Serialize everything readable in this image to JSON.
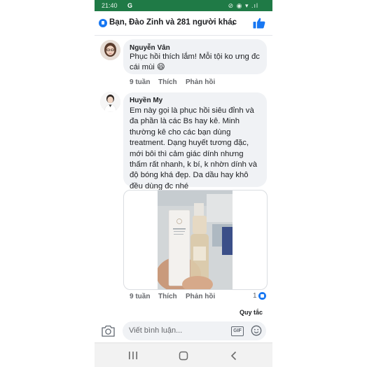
{
  "status_bar": {
    "time": "21:40",
    "google": "G",
    "signals": "⊘ ◉ ▾ .ıl"
  },
  "reactions": {
    "text": "Bạn, Đào Zinh và 281 người khác",
    "chevron": "›"
  },
  "comments": [
    {
      "author": "Nguyễn Vân",
      "text": "Phục hồi thích lắm! Mỗi tội ko ưng đc cái mùi 😄",
      "time": "9 tuần",
      "like": "Thích",
      "reply": "Phản hồi"
    },
    {
      "author": "Huyền My",
      "text": "Em này gọi là phục hồi siêu đỉnh và đa phần là các Bs hay kê. Minh thường kê cho các bạn dùng treatment. Dạng huyết tương đặc, mới bôi thì cảm giác dính nhưng thấm rất nhanh, k bí, k nhờn dính và độ bóng khá đẹp. Da dầu hay khô đều dùng đc nhé",
      "time": "9 tuần",
      "like": "Thích",
      "reply": "Phản hồi",
      "reaction_count": "1"
    }
  ],
  "rules_label": "Quy tắc",
  "composer": {
    "placeholder": "Viết bình luận...",
    "gif": "GIF"
  },
  "icons": {
    "reaction": "like-reaction-icon",
    "thumb": "thumbs-up-icon",
    "camera": "camera-icon",
    "gif": "gif-icon",
    "emoji": "emoji-icon",
    "nav_recent": "recent-apps-icon",
    "nav_home": "home-icon",
    "nav_back": "back-icon"
  },
  "colors": {
    "facebook_blue": "#1877f2",
    "status_bar": "#1f7a46",
    "bubble": "#f0f2f5"
  }
}
